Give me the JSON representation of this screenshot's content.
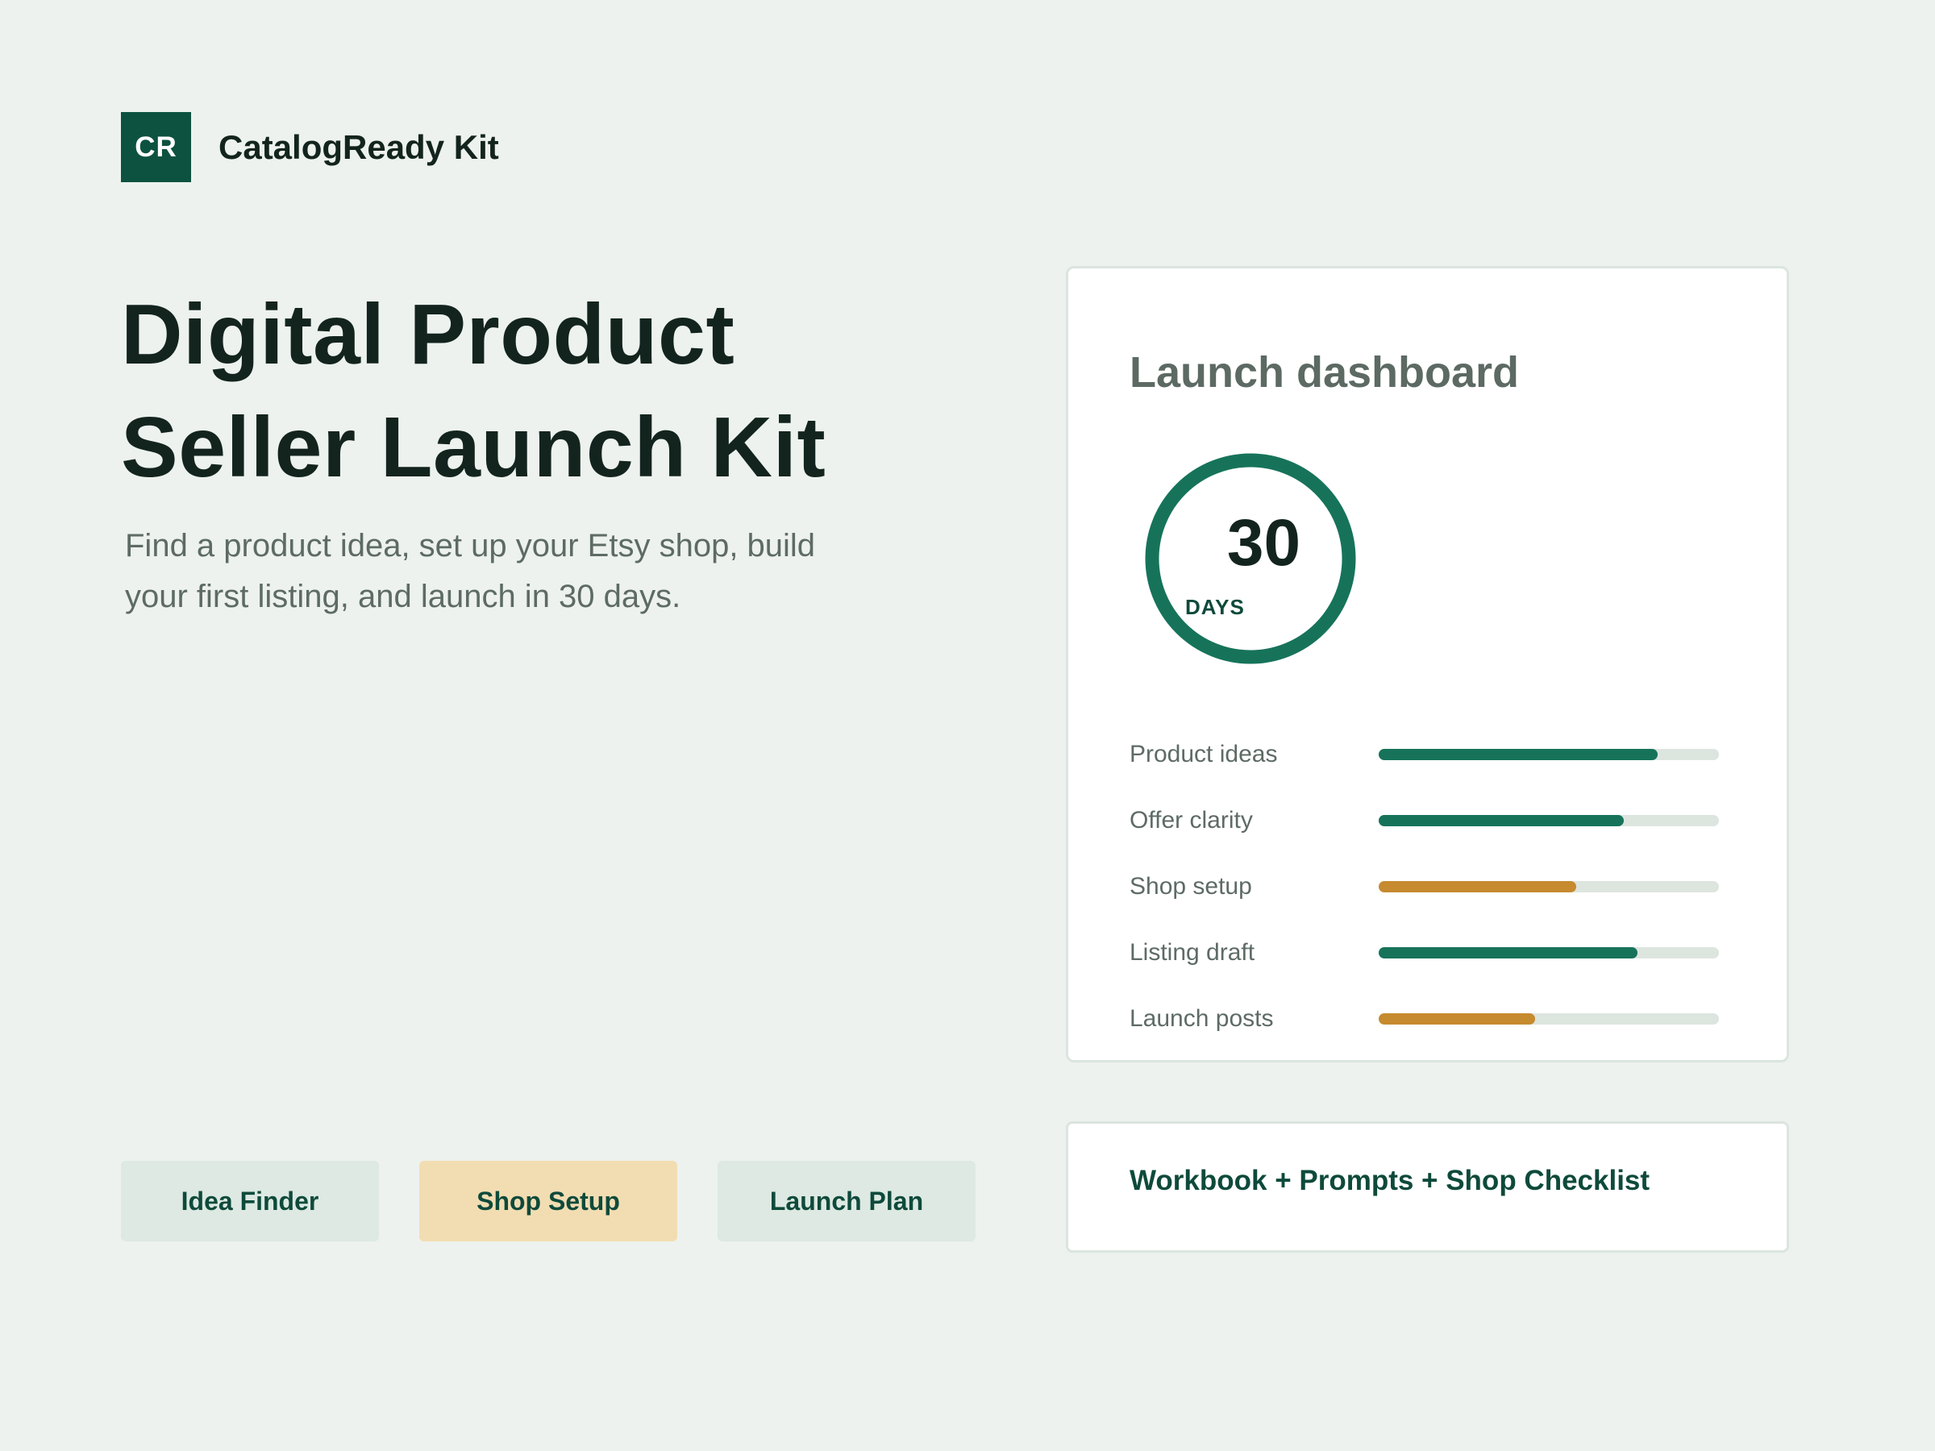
{
  "brand": {
    "initials": "CR",
    "name": "CatalogReady Kit"
  },
  "hero": {
    "title_line1": "Digital Product",
    "title_line2": "Seller Launch Kit",
    "subtitle_line1": "Find a product idea, set up your Etsy shop, build",
    "subtitle_line2": "your first listing, and launch in 30 days."
  },
  "nav": [
    {
      "label": "Idea Finder",
      "tone": "green"
    },
    {
      "label": "Shop Setup",
      "tone": "amber"
    },
    {
      "label": "Launch Plan",
      "tone": "green"
    }
  ],
  "dashboard": {
    "title": "Launch dashboard",
    "ring": {
      "number": "30",
      "unit": "DAYS",
      "color": "#16735a"
    },
    "progress": [
      {
        "label": "Product ideas",
        "value": 0.82,
        "color": "#16735a"
      },
      {
        "label": "Offer clarity",
        "value": 0.72,
        "color": "#16735a"
      },
      {
        "label": "Shop setup",
        "value": 0.58,
        "color": "#c68a2f"
      },
      {
        "label": "Listing draft",
        "value": 0.76,
        "color": "#16735a"
      },
      {
        "label": "Launch posts",
        "value": 0.46,
        "color": "#c68a2f"
      }
    ]
  },
  "bundle": {
    "label": "Workbook + Prompts + Shop Checklist"
  },
  "colors": {
    "background": "#edf2ee",
    "brand": "#0d5240",
    "accent_green": "#16735a",
    "accent_amber": "#c68a2f",
    "track": "#dde5df"
  }
}
